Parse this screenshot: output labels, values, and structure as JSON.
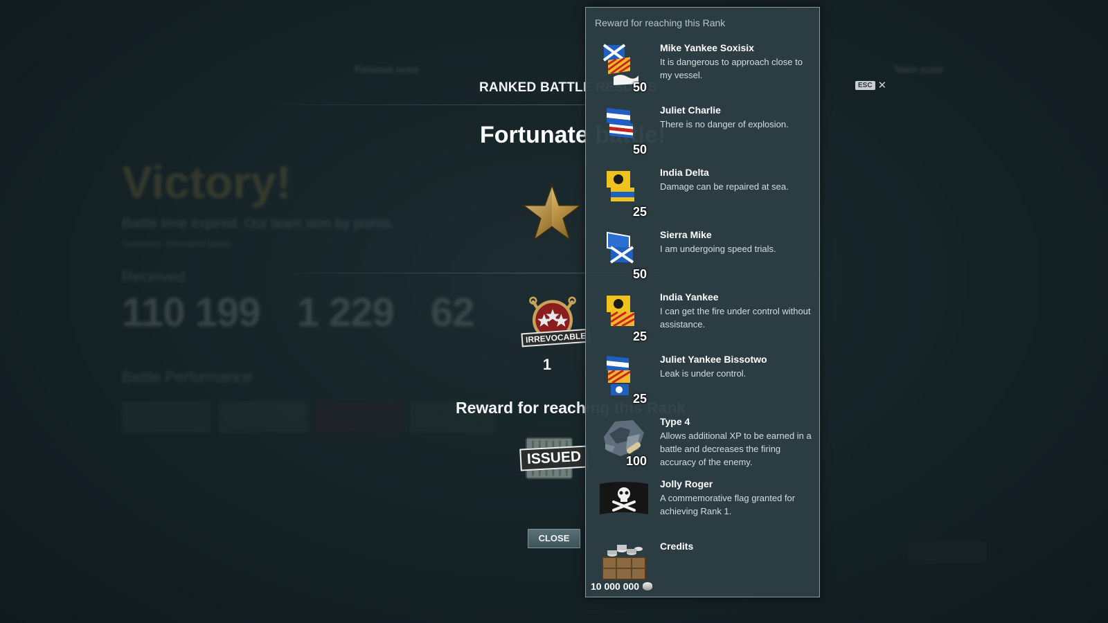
{
  "background": {
    "tabs": [
      "Personal score",
      "Team score"
    ],
    "result_title": "Victory!",
    "result_subtitle": "Battle time expired. Our team won by points.",
    "details_line": "Scenario: Standard battle",
    "earned_label": "Received",
    "earned_values": [
      "110 199",
      "1 229",
      "62"
    ],
    "performance_label": "Battle Performance",
    "battle_button": "BATTLE"
  },
  "dialog": {
    "title": "RANKED BATTLE RESULTS",
    "heading": "Fortunate battle!",
    "rank_badge": "IRREVOCABLE",
    "rank_number": "1",
    "reward_heading": "Reward for reaching this Rank",
    "issued_stamp": "ISSUED",
    "close_label": "CLOSE",
    "esc_label": "ESC"
  },
  "rewards_panel": {
    "title": "Reward for reaching this Rank",
    "items": [
      {
        "name": "Mike Yankee Soxisix",
        "desc": "It is dangerous to approach close to my vessel.",
        "qty": "50",
        "icon": "flag-mike-yankee-soxisix-icon"
      },
      {
        "name": "Juliet Charlie",
        "desc": "There is no danger of explosion.",
        "qty": "50",
        "icon": "flag-juliet-charlie-icon"
      },
      {
        "name": "India Delta",
        "desc": "Damage can be repaired at sea.",
        "qty": "25",
        "icon": "flag-india-delta-icon"
      },
      {
        "name": "Sierra Mike",
        "desc": "I am undergoing speed trials.",
        "qty": "50",
        "icon": "flag-sierra-mike-icon"
      },
      {
        "name": "India Yankee",
        "desc": "I can get the fire under control without assistance.",
        "qty": "25",
        "icon": "flag-india-yankee-icon"
      },
      {
        "name": "Juliet Yankee Bissotwo",
        "desc": "Leak is under control.",
        "qty": "25",
        "icon": "flag-juliet-yankee-bissotwo-icon"
      },
      {
        "name": "Type 4",
        "desc": "Allows additional XP to be earned in a battle and decreases the firing accuracy of the enemy.",
        "qty": "100",
        "icon": "camouflage-type-4-icon"
      },
      {
        "name": "Jolly Roger",
        "desc": "A commemorative flag granted for achieving Rank 1.",
        "qty": "",
        "icon": "flag-jolly-roger-icon"
      },
      {
        "name": "Credits",
        "desc": "",
        "qty": "",
        "icon": "credits-crate-icon"
      }
    ],
    "credits_amount": "10 000 000"
  }
}
